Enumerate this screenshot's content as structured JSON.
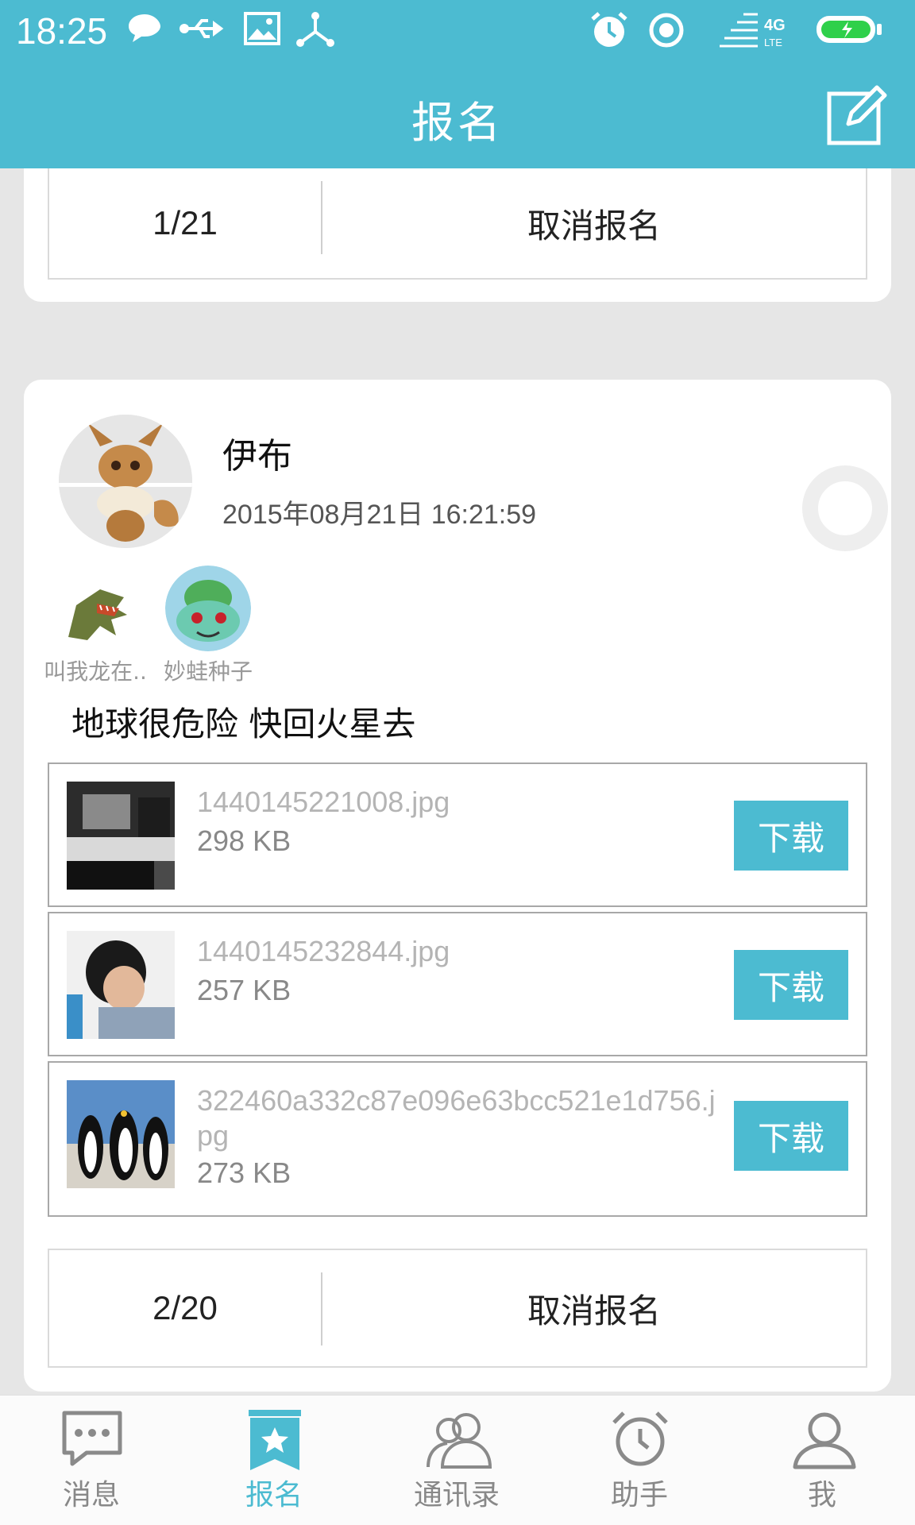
{
  "status_bar": {
    "time": "18:25"
  },
  "header": {
    "title": "报名"
  },
  "top_card": {
    "count": "1/21",
    "cancel_label": "取消报名"
  },
  "post": {
    "user_name": "伊布",
    "timestamp": "2015年08月21日 16:21:59",
    "participants": [
      {
        "name": "叫我龙在.."
      },
      {
        "name": "妙蛙种子"
      }
    ],
    "text": "地球很危险  快回火星去",
    "files": [
      {
        "name": "1440145221008.jpg",
        "size": "298 KB",
        "download_label": "下载"
      },
      {
        "name": "1440145232844.jpg",
        "size": "257 KB",
        "download_label": "下载"
      },
      {
        "name": "322460a332c87e096e63bcc521e1d756.jpg",
        "size": "273 KB",
        "download_label": "下载"
      }
    ],
    "count": "2/20",
    "cancel_label": "取消报名"
  },
  "bottom_nav": [
    {
      "label": "消息",
      "icon": "chat-icon"
    },
    {
      "label": "报名",
      "icon": "bookmark-star-icon",
      "active": true
    },
    {
      "label": "通讯录",
      "icon": "contacts-icon"
    },
    {
      "label": "助手",
      "icon": "alarm-clock-icon"
    },
    {
      "label": "我",
      "icon": "person-icon"
    }
  ],
  "colors": {
    "accent": "#4cbbd1",
    "background": "#e6e6e6"
  }
}
